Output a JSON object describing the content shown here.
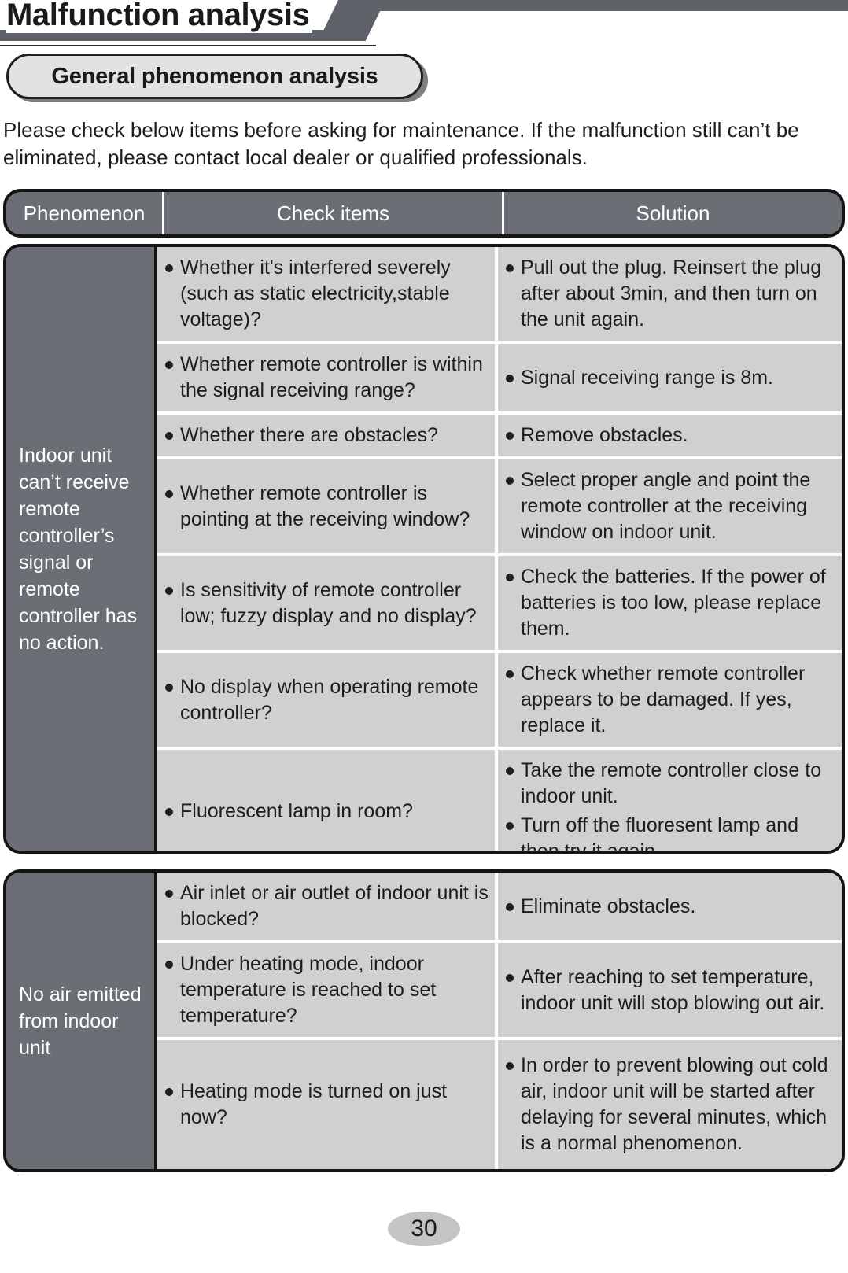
{
  "header": {
    "title": "Malfunction analysis",
    "section_pill": "General phenomenon analysis",
    "accent_dark": "#5d6168",
    "pill_fill": "#e2e2e0"
  },
  "intro": "Please check below items before asking for maintenance. If the malfunction still can’t be eliminated, please contact local dealer or qualified professionals.",
  "table": {
    "columns": [
      "Phenomenon",
      "Check items",
      "Solution"
    ],
    "header_bg": "#6b6e74",
    "cell_bg": "#d0d0d0",
    "sections": [
      {
        "phenomenon": "Indoor unit can’t receive remote controller’s signal or remote controller has no action.",
        "rows": [
          {
            "check": [
              "Whether it's interfered severely (such as static electricity,stable voltage)?"
            ],
            "solution": [
              "Pull out the plug. Reinsert the plug after about 3min, and then turn on the unit again."
            ]
          },
          {
            "check": [
              "Whether remote controller is within the signal receiving range?"
            ],
            "solution": [
              "Signal receiving range is 8m."
            ]
          },
          {
            "check": [
              "Whether there are obstacles?"
            ],
            "solution": [
              "Remove obstacles."
            ]
          },
          {
            "check": [
              "Whether remote controller is pointing at the receiving window?"
            ],
            "solution": [
              "Select proper angle and point the remote controller at the receiving window on indoor unit."
            ]
          },
          {
            "check": [
              "Is sensitivity of remote controller low; fuzzy display and no display?"
            ],
            "solution": [
              "Check the batteries. If the power of batteries is too low, please replace them."
            ]
          },
          {
            "check": [
              "No display when operating remote controller?"
            ],
            "solution": [
              "Check whether remote controller appears to be damaged. If yes, replace it."
            ]
          },
          {
            "check": [
              "Fluorescent lamp in room?"
            ],
            "solution": [
              "Take the remote controller close to indoor unit.",
              "Turn off the fluoresent lamp and then try it again."
            ]
          }
        ]
      },
      {
        "phenomenon": "No air emitted from indoor unit",
        "rows": [
          {
            "check": [
              "Air inlet or air outlet of indoor unit is blocked?"
            ],
            "solution": [
              "Eliminate obstacles."
            ]
          },
          {
            "check": [
              "Under heating mode, indoor temperature is reached to set temperature?"
            ],
            "solution": [
              "After reaching to set temperature, indoor unit will stop blowing out air."
            ]
          },
          {
            "check": [
              "Heating mode is turned on just now?"
            ],
            "solution": [
              "In order to prevent blowing out cold air, indoor unit will be started after delaying for several minutes, which is a normal phenomenon."
            ]
          }
        ]
      }
    ]
  },
  "footer": {
    "page_number": "30"
  }
}
